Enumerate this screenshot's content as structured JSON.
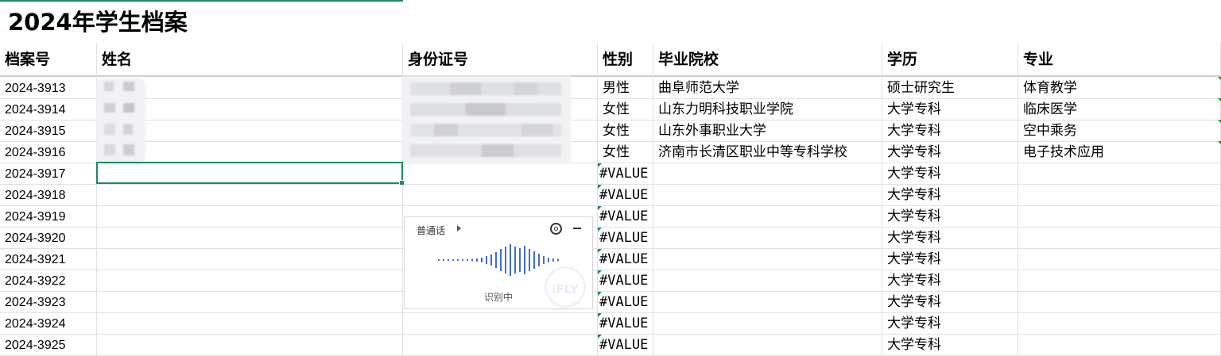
{
  "sheet": {
    "title": "2024年学生档案",
    "headers": [
      "档案号",
      "姓名",
      "身份证号",
      "性别",
      "毕业院校",
      "学历",
      "专业"
    ],
    "rows": [
      {
        "id": "2024-3913",
        "gender": "男性",
        "school": "曲阜师范大学",
        "edu": "硕士研究生",
        "major": "体育教学"
      },
      {
        "id": "2024-3914",
        "gender": "女性",
        "school": "山东力明科技职业学院",
        "edu": "大学专科",
        "major": "临床医学"
      },
      {
        "id": "2024-3915",
        "gender": "女性",
        "school": "山东外事职业大学",
        "edu": "大学专科",
        "major": "空中乘务"
      },
      {
        "id": "2024-3916",
        "gender": "女性",
        "school": "济南市长清区职业中等专科学校",
        "edu": "大学专科",
        "major": "电子技术应用"
      },
      {
        "id": "2024-3917",
        "gender": "#VALUE",
        "school": "",
        "edu": "大学专科",
        "major": ""
      },
      {
        "id": "2024-3918",
        "gender": "#VALUE",
        "school": "",
        "edu": "大学专科",
        "major": ""
      },
      {
        "id": "2024-3919",
        "gender": "#VALUE",
        "school": "",
        "edu": "大学专科",
        "major": ""
      },
      {
        "id": "2024-3920",
        "gender": "#VALUE",
        "school": "",
        "edu": "大学专科",
        "major": ""
      },
      {
        "id": "2024-3921",
        "gender": "#VALUE",
        "school": "",
        "edu": "大学专科",
        "major": ""
      },
      {
        "id": "2024-3922",
        "gender": "#VALUE",
        "school": "",
        "edu": "大学专科",
        "major": ""
      },
      {
        "id": "2024-3923",
        "gender": "#VALUE",
        "school": "",
        "edu": "大学专科",
        "major": ""
      },
      {
        "id": "2024-3924",
        "gender": "#VALUE",
        "school": "",
        "edu": "大学专科",
        "major": ""
      },
      {
        "id": "2024-3925",
        "gender": "#VALUE",
        "school": "",
        "edu": "大学专科",
        "major": ""
      }
    ]
  },
  "voice_panel": {
    "language": "普通话",
    "status": "识别中",
    "logo": "iFLY",
    "icons": [
      "play-triangle-icon",
      "settings-icon",
      "minimize-icon",
      "waveform-icon"
    ]
  },
  "colors": {
    "accent_green": "#1e8c5a",
    "wave_blue": "#3f6fcf"
  }
}
